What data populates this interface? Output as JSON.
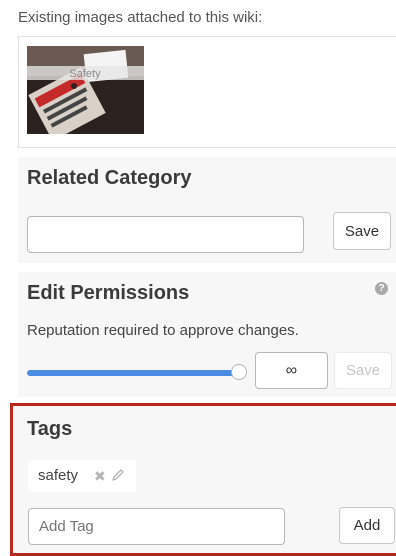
{
  "existing_images": {
    "label": "Existing images attached to this wiki:",
    "thumbnail_text": "Safety"
  },
  "related_category": {
    "title": "Related Category",
    "input_value": "",
    "save_label": "Save"
  },
  "edit_permissions": {
    "title": "Edit Permissions",
    "help_glyph": "?",
    "description": "Reputation required to approve changes.",
    "slider_level_percent": 100,
    "value": "∞",
    "save_label": "Save"
  },
  "tags": {
    "title": "Tags",
    "items": [
      {
        "label": "safety"
      }
    ],
    "add_placeholder": "Add Tag",
    "add_label": "Add"
  },
  "colors": {
    "accent": "#4a8de0",
    "highlight_border": "#b8281c",
    "panel_bg": "#f7f7f7"
  }
}
